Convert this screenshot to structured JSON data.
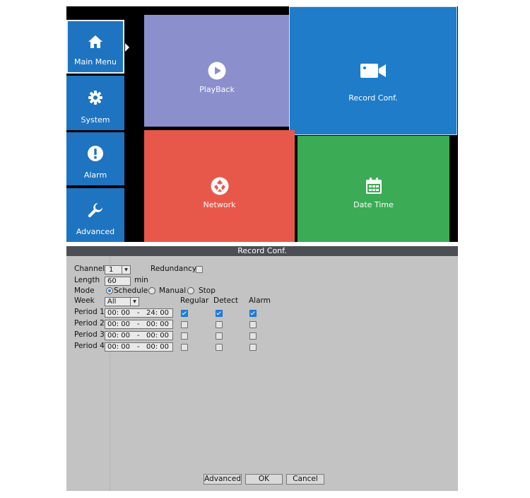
{
  "sidebar": {
    "items": [
      {
        "label": "Main Menu",
        "icon": "home-icon"
      },
      {
        "label": "System",
        "icon": "gear-icon"
      },
      {
        "label": "Alarm",
        "icon": "alarm-icon"
      },
      {
        "label": "Advanced",
        "icon": "wrench-icon"
      }
    ]
  },
  "tiles": [
    {
      "label": "PlayBack",
      "icon": "play-icon",
      "color": "#8b8fcc"
    },
    {
      "label": "Record Conf.",
      "icon": "camera-icon",
      "color": "#1e7cc8"
    },
    {
      "label": "Network",
      "icon": "network-icon",
      "color": "#e8584a"
    },
    {
      "label": "Date Time",
      "icon": "calendar-icon",
      "color": "#3bab55"
    }
  ],
  "dialog": {
    "title": "Record Conf.",
    "channel_label": "Channel",
    "channel_value": "1",
    "redundancy_label": "Redundancy",
    "length_label": "Length",
    "length_value": "60",
    "length_unit": "min",
    "mode_label": "Mode",
    "mode_options": [
      "Schedule",
      "Manual",
      "Stop"
    ],
    "mode_selected": "Schedule",
    "week_label": "Week",
    "week_value": "All",
    "col_headers": [
      "Regular",
      "Detect",
      "Alarm"
    ],
    "periods": [
      {
        "label": "Period 1",
        "start": "00: 00",
        "end": "24: 00",
        "regular": true,
        "detect": true,
        "alarm": true
      },
      {
        "label": "Period 2",
        "start": "00: 00",
        "end": "00: 00",
        "regular": false,
        "detect": false,
        "alarm": false
      },
      {
        "label": "Period 3",
        "start": "00: 00",
        "end": "00: 00",
        "regular": false,
        "detect": false,
        "alarm": false
      },
      {
        "label": "Period 4",
        "start": "00: 00",
        "end": "00: 00",
        "regular": false,
        "detect": false,
        "alarm": false
      }
    ],
    "buttons": {
      "advanced": "Advanced",
      "ok": "OK",
      "cancel": "Cancel"
    }
  }
}
